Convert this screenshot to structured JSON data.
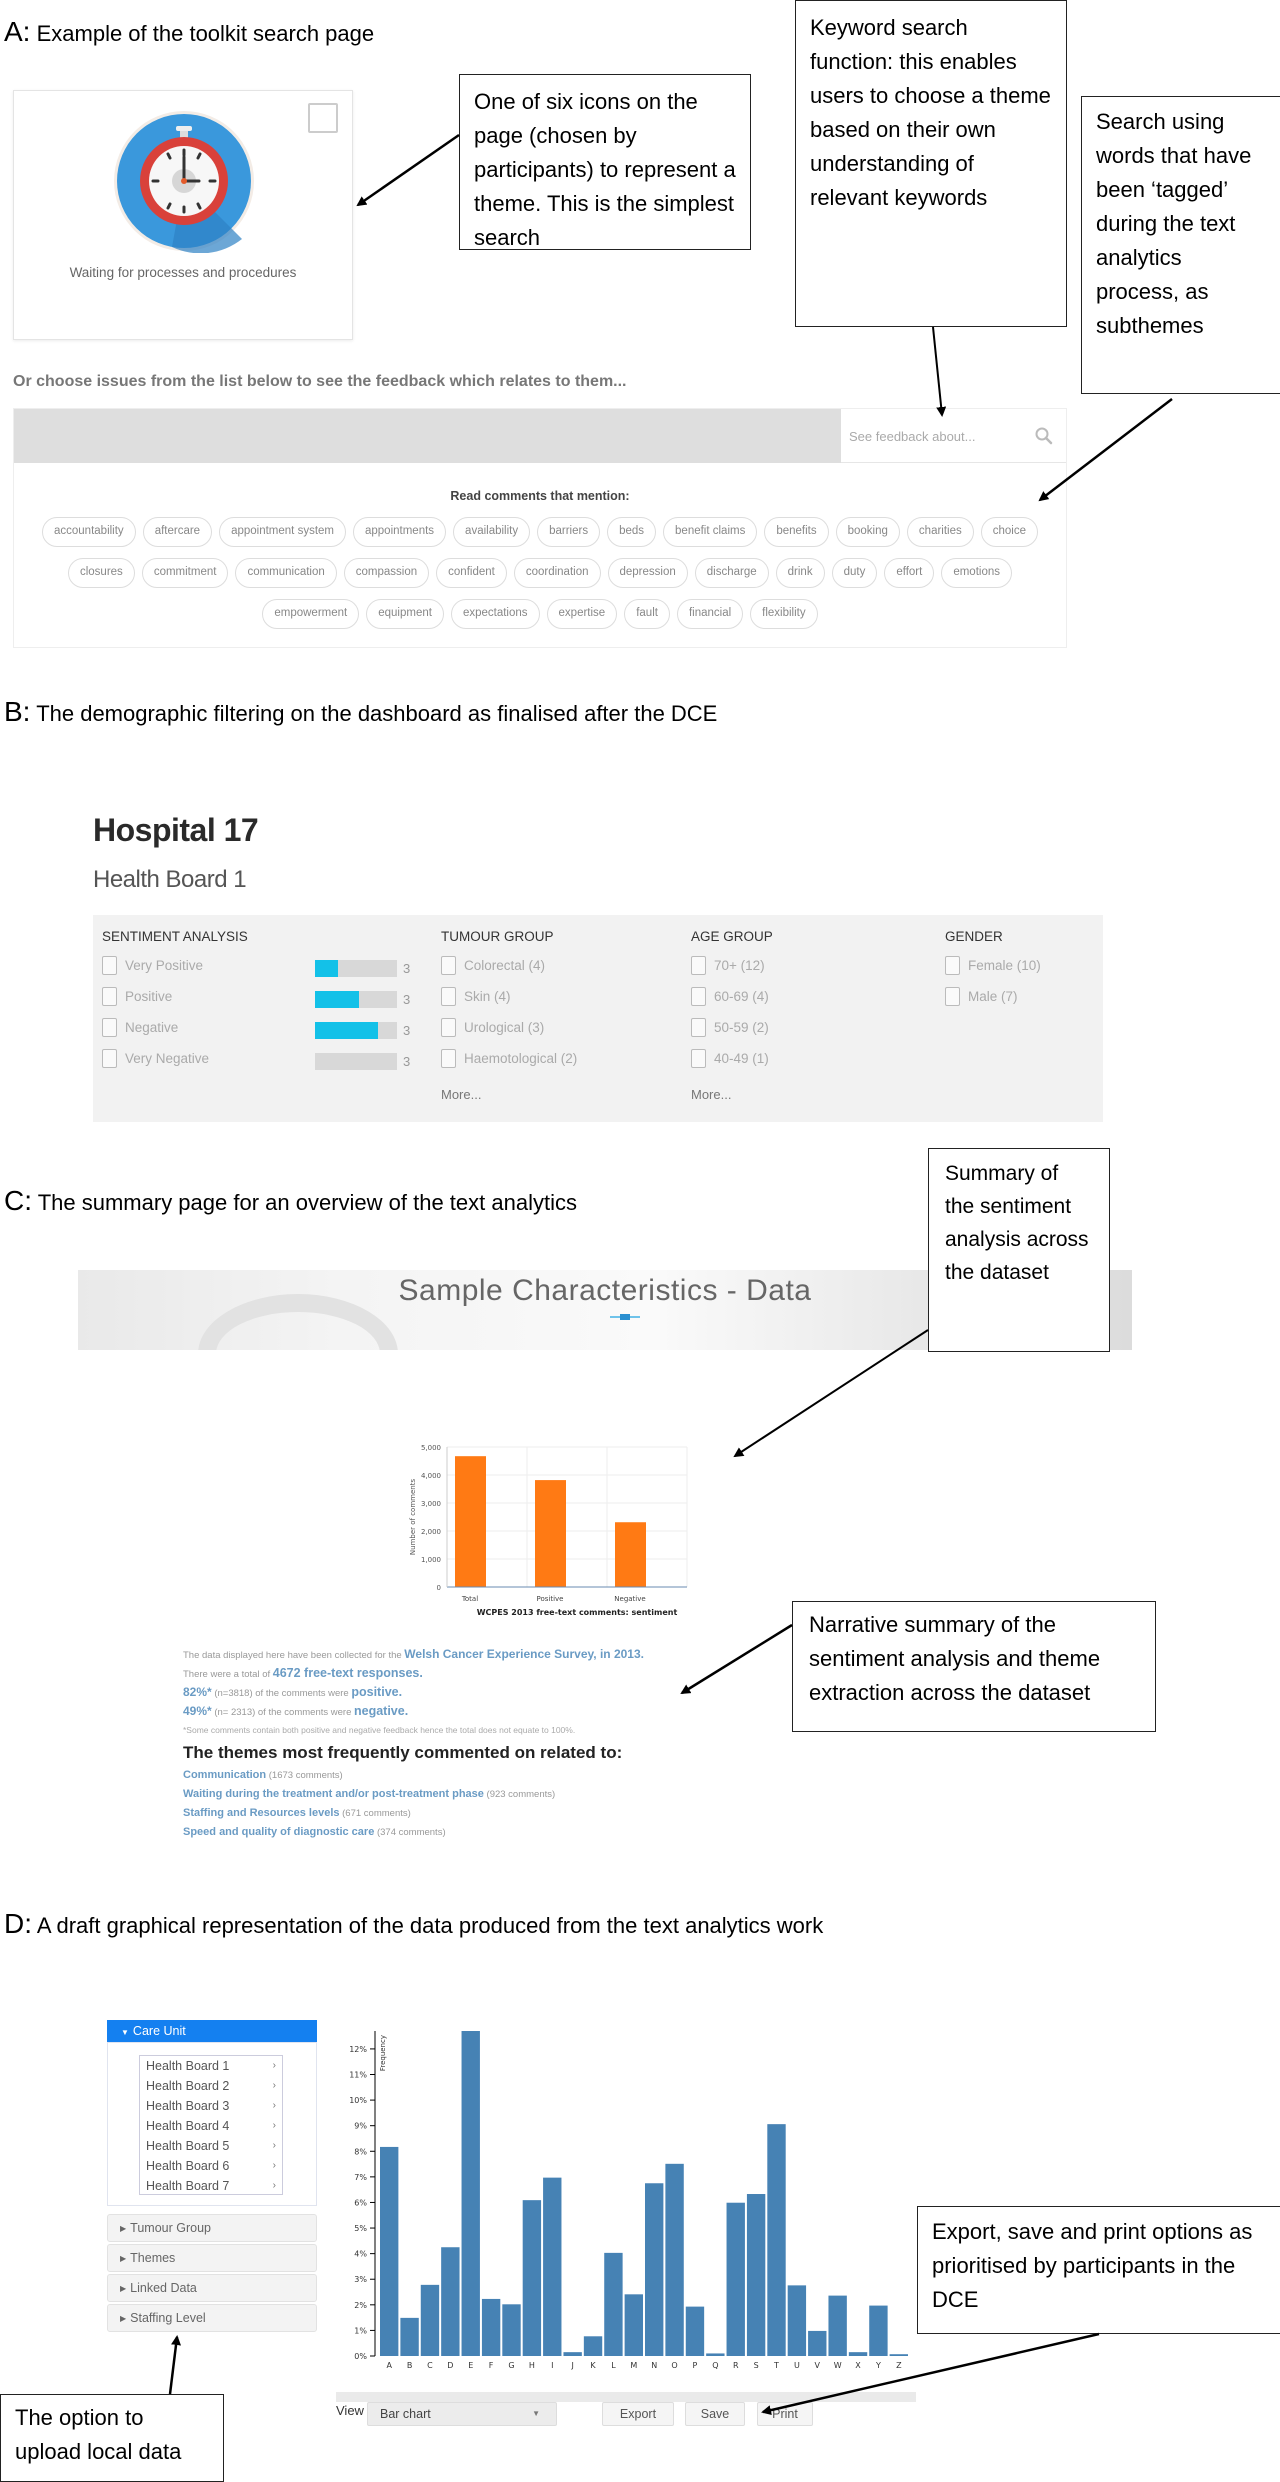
{
  "sections": {
    "a": {
      "letter": "A:",
      "title": "Example of the toolkit search page"
    },
    "b": {
      "letter": "B:",
      "title": "The demographic filtering on the dashboard as finalised after the DCE"
    },
    "c": {
      "letter": "C:",
      "title": "The summary page for an overview of the text analytics"
    },
    "d": {
      "letter": "D:",
      "title": "A draft graphical representation of the data produced from the text analytics work"
    }
  },
  "callouts": {
    "icon": "One of six icons on the page (chosen by participants) to represent a theme. This is the simplest search",
    "keyword": "Keyword search function: this enables users to choose a theme based on their own understanding of relevant keywords",
    "tagged": "Search using words that have been ‘tagged’ during the text analytics process, as subthemes",
    "sentiment_summary": "Summary of the sentiment analysis across the dataset",
    "narrative": "Narrative summary of the sentiment analysis and theme extraction across the dataset",
    "export": "Export, save and print options as prioritised by participants in the DCE",
    "upload": "The option to upload local data"
  },
  "search_page": {
    "theme_card": {
      "label": "Waiting for processes and procedures",
      "icon": "stopwatch-icon",
      "checked": false
    },
    "choose_title": "Or choose issues from the list below to see the feedback which relates to them...",
    "search_placeholder": "See feedback about...",
    "read_label": "Read comments that mention:",
    "tag_rows": [
      [
        "accountability",
        "aftercare",
        "appointment system",
        "appointments",
        "availability",
        "barriers",
        "beds",
        "benefit claims",
        "benefits",
        "booking",
        "charities",
        "choice"
      ],
      [
        "closures",
        "commitment",
        "communication",
        "compassion",
        "confident",
        "coordination",
        "depression",
        "discharge",
        "drink",
        "duty",
        "effort",
        "emotions"
      ],
      [
        "empowerment",
        "equipment",
        "expectations",
        "expertise",
        "fault",
        "financial",
        "flexibility"
      ]
    ]
  },
  "dashboard": {
    "hospital": "Hospital 17",
    "health_board": "Health Board 1",
    "sentiment": {
      "heading": "SENTIMENT ANALYSIS",
      "items": [
        {
          "label": "Very Positive",
          "fill": 0.28,
          "count": "3"
        },
        {
          "label": "Positive",
          "fill": 0.54,
          "count": "3"
        },
        {
          "label": "Negative",
          "fill": 0.77,
          "count": "3"
        },
        {
          "label": "Very Negative",
          "fill": 0.0,
          "count": "3"
        }
      ],
      "accent": "#13c1e8"
    },
    "tumour": {
      "heading": "TUMOUR GROUP",
      "items": [
        "Colorectal (4)",
        "Skin (4)",
        "Urological (3)",
        "Haemotological (2)"
      ],
      "more": "More..."
    },
    "age": {
      "heading": "AGE GROUP",
      "items": [
        "70+ (12)",
        "60-69 (4)",
        "50-59 (2)",
        "40-49 (1)"
      ],
      "more": "More..."
    },
    "gender": {
      "heading": "GENDER",
      "items": [
        "Female (10)",
        "Male (7)"
      ]
    }
  },
  "summary": {
    "banner_title": "Sample Characteristics - Data",
    "narrative": {
      "l1_pre": "The data displayed here have been collected for the",
      "l1_hl": "Welsh Cancer Experience Survey, in 2013.",
      "l2_pre": "There were a total of",
      "l2_hl": "4672 free-text responses.",
      "l3_hl": "82%*",
      "l3_mid": "(n=3818) of the comments were",
      "l3_hl2": "positive.",
      "l4_hl": "49%*",
      "l4_mid": "(n= 2313) of the comments were",
      "l4_hl2": "negative.",
      "note": "*Some comments contain both positive and negative feedback hence the total does not equate to 100%.",
      "themes_heading": "The themes most frequently commented on related to:",
      "themes": [
        {
          "name": "Communication",
          "count": "(1673 comments)"
        },
        {
          "name": "Waiting during the treatment and/or post-treatment phase",
          "count": "(923 comments)"
        },
        {
          "name": "Staffing and Resources levels",
          "count": "(671 comments)"
        },
        {
          "name": "Speed and quality of diagnostic care",
          "count": "(374 comments)"
        }
      ]
    }
  },
  "graph_page": {
    "care_unit": "Care Unit",
    "health_boards": [
      "Health Board 1",
      "Health Board 2",
      "Health Board 3",
      "Health Board 4",
      "Health Board 5",
      "Health Board 6",
      "Health Board 7"
    ],
    "accordions": [
      "Tumour Group",
      "Themes",
      "Linked Data",
      "Staffing Level"
    ],
    "view_label": "View",
    "view_selected": "Bar chart",
    "buttons": {
      "export": "Export",
      "save": "Save",
      "print": "Print"
    }
  },
  "chart_data": [
    {
      "type": "bar",
      "title": "WCPES 2013 free-text comments: sentiment",
      "xlabel": "",
      "ylabel": "Number of comments",
      "categories": [
        "Total",
        "Positive",
        "Negative"
      ],
      "values": [
        4672,
        3818,
        2313
      ],
      "ylim": [
        0,
        5000
      ],
      "yticks": [
        0,
        1000,
        2000,
        3000,
        4000,
        5000
      ],
      "ytick_labels": [
        "0",
        "1,000",
        "2,000",
        "3,000",
        "4,000",
        "5,000"
      ],
      "grid": true,
      "color": "#ff7a14"
    },
    {
      "type": "bar",
      "title": "",
      "xlabel": "",
      "ylabel": "Frequency",
      "categories": [
        "A",
        "B",
        "C",
        "D",
        "E",
        "F",
        "G",
        "H",
        "I",
        "J",
        "K",
        "L",
        "M",
        "N",
        "O",
        "P",
        "Q",
        "R",
        "S",
        "T",
        "U",
        "V",
        "W",
        "X",
        "Y",
        "Z"
      ],
      "values": [
        8.17,
        1.49,
        2.78,
        4.25,
        12.7,
        2.23,
        2.02,
        6.09,
        6.97,
        0.15,
        0.77,
        4.03,
        2.41,
        6.75,
        7.51,
        1.93,
        0.1,
        5.99,
        6.33,
        9.06,
        2.76,
        0.98,
        2.36,
        0.15,
        1.97,
        0.07
      ],
      "unit": "%",
      "ylim": [
        0,
        12.7
      ],
      "yticks": [
        0,
        1,
        2,
        3,
        4,
        5,
        6,
        7,
        8,
        9,
        10,
        11,
        12
      ],
      "grid": false,
      "color": "#4682b4"
    }
  ]
}
